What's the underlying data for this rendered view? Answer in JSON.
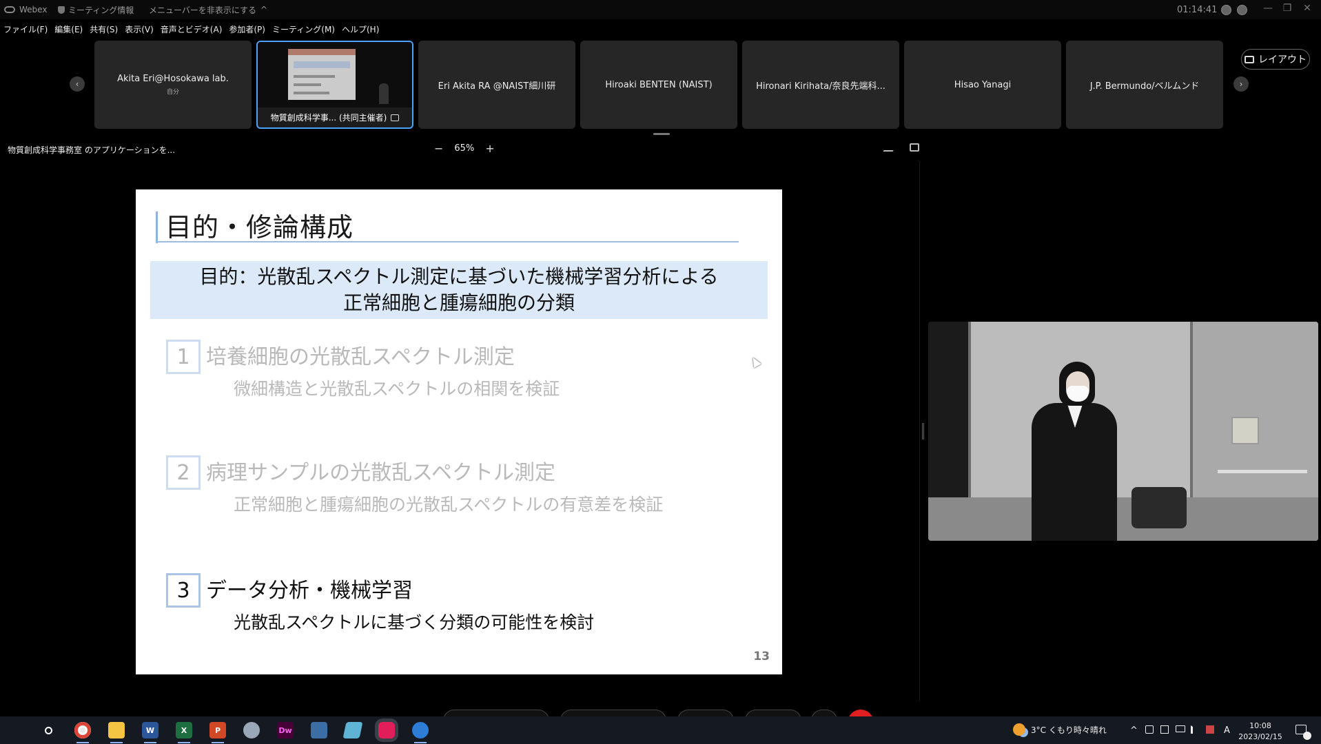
{
  "titlebar": {
    "app_name": "Webex",
    "meeting_info": "ミーティング情報",
    "hide_menu": "メニューバーを非表示にする",
    "hide_menu_chevron": "^",
    "elapsed_time": "01:14:41",
    "minimize": "—",
    "restore": "❐",
    "close": "✕"
  },
  "menubar": {
    "items": [
      {
        "label": "ファイル(F)"
      },
      {
        "label": "編集(E)"
      },
      {
        "label": "共有(S)"
      },
      {
        "label": "表示(V)"
      },
      {
        "label": "音声とビデオ(A)"
      },
      {
        "label": "参加者(P)"
      },
      {
        "label": "ミーティング(M)"
      },
      {
        "label": "ヘルプ(H)"
      }
    ]
  },
  "participants": {
    "prev_arrow": "‹",
    "next_arrow": "›",
    "tiles": [
      {
        "name": "Akita Eri@Hosokawa lab.",
        "sub": "自分"
      },
      {
        "name": "物質創成科学事... (共同主催者)"
      },
      {
        "name": "Eri Akita RA @NAIST細川研"
      },
      {
        "name": "Hiroaki BENTEN (NAIST)"
      },
      {
        "name": "Hironari Kirihata/奈良先端科..."
      },
      {
        "name": "Hisao Yanagi"
      },
      {
        "name": "J.P. Bermundo/ベルムンド"
      }
    ],
    "layout_button": "レイアウト"
  },
  "share_toolbar": {
    "sharing_label": "物質創成科学事務室 のアプリケーションを...",
    "zoom_out": "−",
    "zoom_level": "65%",
    "zoom_in": "+"
  },
  "slide": {
    "title": "目的・修論構成",
    "purpose_line1": "目的：光散乱スペクトル測定に基づいた機械学習分析による",
    "purpose_line2": "正常細胞と腫瘍細胞の分類",
    "steps": [
      {
        "num": "1",
        "head": "培養細胞の光散乱スペクトル測定",
        "desc": "微細構造と光散乱スペクトルの相関を検証"
      },
      {
        "num": "2",
        "head": "病理サンプルの光散乱スペクトル測定",
        "desc": "正常細胞と腫瘍細胞の光散乱スペクトルの有意差を検証"
      },
      {
        "num": "3",
        "head": "データ分析・機械学習",
        "desc": "光散乱スペクトルに基づく分類の可能性を検討"
      }
    ],
    "page_number": "13"
  },
  "taskbar": {
    "apps": [
      "chrome",
      "file-explorer",
      "word",
      "excel",
      "powerpoint",
      "app-6",
      "dreamweaver",
      "app-8",
      "app-9",
      "slack",
      "webex"
    ],
    "word_letter": "W",
    "excel_letter": "X",
    "ppt_letter": "P",
    "dw_letters": "Dw",
    "weather": "3°C くもり時々晴れ",
    "tray_chevron": "^",
    "ime": "A",
    "time": "10:08",
    "date": "2023/02/15"
  },
  "colors": {
    "accent": "#4aa3ff",
    "slide_band": "#dce9f8",
    "end_call": "#e02020"
  }
}
